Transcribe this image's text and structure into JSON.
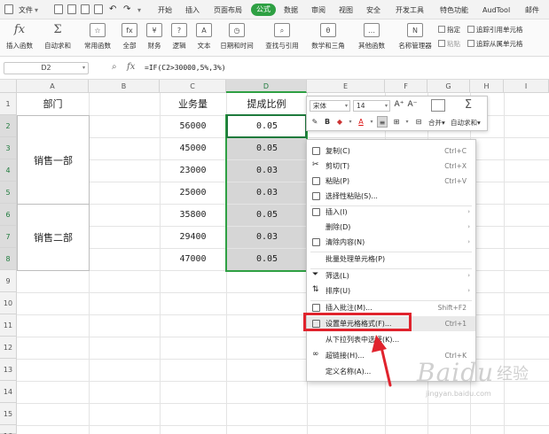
{
  "menubar": {
    "file": "文件",
    "tabs": [
      "开始",
      "插入",
      "页面布局",
      "公式",
      "数据",
      "审阅",
      "视图",
      "安全",
      "开发工具",
      "特色功能",
      "AudTool",
      "邮件"
    ],
    "active_tab": "公式"
  },
  "ribbon": {
    "insert_fn": "插入函数",
    "autosum": "自动求和",
    "common_fn": "常用函数",
    "all": "全部",
    "finance": "财务",
    "logic": "逻辑",
    "text": "文本",
    "datetime": "日期和时间",
    "lookup": "查找与引用",
    "math": "数学和三角",
    "other_fn": "其他函数",
    "name_mgr": "名称管理器",
    "define": "指定",
    "paste": "粘贴",
    "trace_prec": "追踪引用单元格",
    "trace_dep": "追踪从属单元格"
  },
  "formula_bar": {
    "name_box": "D2",
    "formula": "=IF(C2>30000,5%,3%)"
  },
  "grid": {
    "columns": [
      "A",
      "B",
      "C",
      "D",
      "E",
      "F",
      "G",
      "H",
      "I"
    ],
    "rows": [
      "1",
      "2",
      "3",
      "4",
      "5",
      "6",
      "7",
      "8",
      "9",
      "10",
      "11",
      "12",
      "13",
      "14",
      "15",
      "16"
    ],
    "header_dept": "部门",
    "header_sales": "业务量",
    "header_rate": "提成比例",
    "dept1": "销售一部",
    "dept2": "销售二部",
    "sales": [
      "56000",
      "45000",
      "23000",
      "25000",
      "35800",
      "29400",
      "47000"
    ],
    "rates": [
      "0.05",
      "0.05",
      "0.03",
      "0.03",
      "0.05",
      "0.03",
      "0.05"
    ]
  },
  "mini_toolbar": {
    "font": "宋体",
    "size": "14",
    "merge": "合并",
    "autosum": "自动求和"
  },
  "context_menu": {
    "items": [
      {
        "label": "复制(C)",
        "shortcut": "Ctrl+C"
      },
      {
        "label": "剪切(T)",
        "shortcut": "Ctrl+X"
      },
      {
        "label": "粘贴(P)",
        "shortcut": "Ctrl+V"
      },
      {
        "label": "选择性粘贴(S)...",
        "shortcut": ""
      },
      {
        "label": "插入(I)",
        "shortcut": ""
      },
      {
        "label": "删除(D)",
        "shortcut": ""
      },
      {
        "label": "清除内容(N)",
        "shortcut": ""
      },
      {
        "label": "批量处理单元格(P)",
        "shortcut": ""
      },
      {
        "label": "筛选(L)",
        "shortcut": ""
      },
      {
        "label": "排序(U)",
        "shortcut": ""
      },
      {
        "label": "插入批注(M)...",
        "shortcut": "Shift+F2"
      },
      {
        "label": "设置单元格格式(F)...",
        "shortcut": "Ctrl+1"
      },
      {
        "label": "从下拉列表中选择(K)...",
        "shortcut": ""
      },
      {
        "label": "超链接(H)...",
        "shortcut": "Ctrl+K"
      },
      {
        "label": "定义名称(A)...",
        "shortcut": ""
      }
    ]
  },
  "watermark": {
    "brand": "Baidu",
    "cn": "经验",
    "url": "jingyan.baidu.com"
  },
  "colors": {
    "accent": "#2ea043",
    "highlight": "#e0232d",
    "selected_fill": "#d6d6d6"
  }
}
